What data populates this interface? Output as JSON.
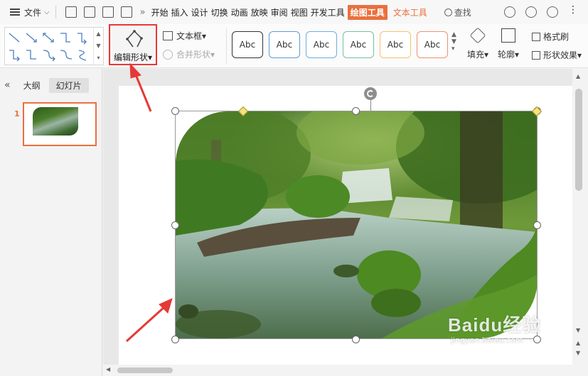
{
  "menubar": {
    "file_label": "文件",
    "tabs": [
      "开始",
      "插入",
      "设计",
      "切换",
      "动画",
      "放映",
      "审阅",
      "视图",
      "开发工具"
    ],
    "drawing_tools_tab": "绘图工具",
    "text_tools_tab": "文本工具",
    "search_label": "查找"
  },
  "ribbon": {
    "edit_shape_label": "编辑形状",
    "textbox_label": "文本框",
    "merge_shapes_label": "合并形状",
    "styles": [
      {
        "label": "Abc",
        "color": "#333333"
      },
      {
        "label": "Abc",
        "color": "#5b9bd5"
      },
      {
        "label": "Abc",
        "color": "#6aaee0"
      },
      {
        "label": "Abc",
        "color": "#70c3a0"
      },
      {
        "label": "Abc",
        "color": "#f5c26b"
      },
      {
        "label": "Abc",
        "color": "#f0906e"
      }
    ],
    "fill_label": "填充",
    "outline_label": "轮廓",
    "format_painter_label": "格式刷",
    "shape_effect_label": "形状效果"
  },
  "leftpane": {
    "outline_tab": "大纲",
    "slides_tab": "幻灯片",
    "slide_number": "1"
  },
  "watermark": {
    "main": "Baidu经验",
    "sub": "jingyan.baidu.com"
  },
  "colors": {
    "accent_orange": "#e9703e",
    "highlight_red": "#e53935"
  }
}
